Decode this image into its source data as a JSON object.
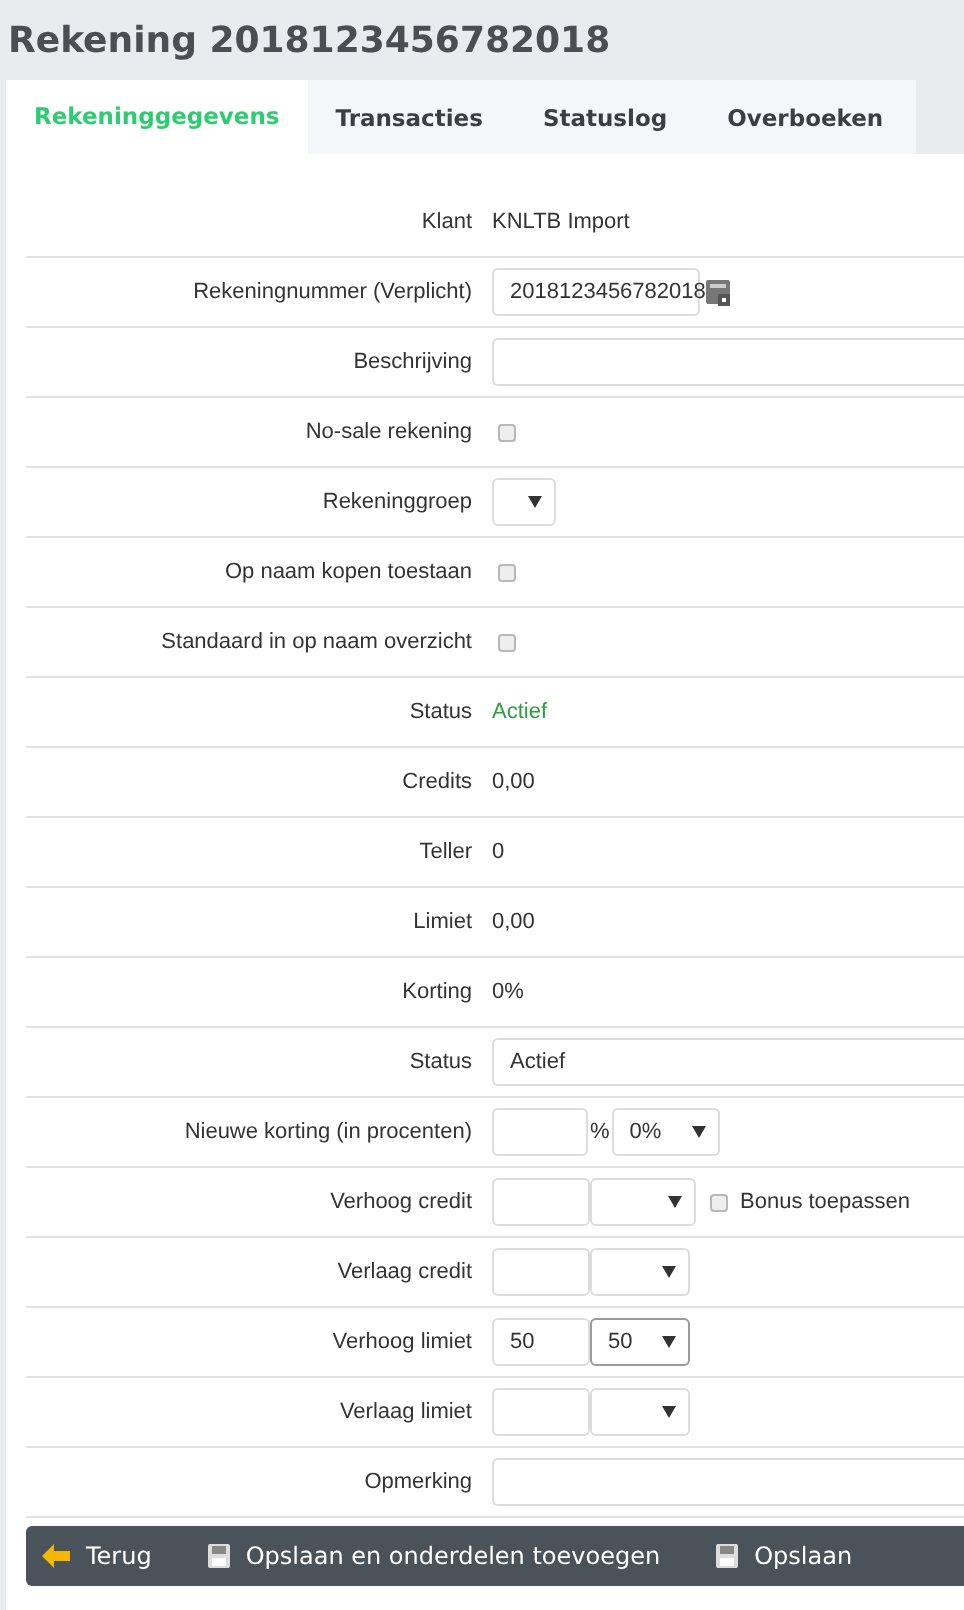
{
  "title": "Rekening 2018123456782018",
  "tabs": [
    {
      "label": "Rekeninggegevens",
      "selected": true
    },
    {
      "label": "Transacties",
      "selected": false
    },
    {
      "label": "Statuslog",
      "selected": false
    },
    {
      "label": "Overboeken",
      "selected": false
    }
  ],
  "rows": [
    {
      "label": "Klant",
      "kind": "text",
      "value": "KNLTB Import"
    },
    {
      "label": "Rekeningnummer (Verplicht)",
      "kind": "field-icon",
      "value": "2018123456782018"
    },
    {
      "label": "Beschrijving",
      "kind": "wide-field"
    },
    {
      "label": "No-sale rekening",
      "kind": "checkbox",
      "checked": false
    },
    {
      "label": "Rekeninggroep",
      "kind": "select"
    },
    {
      "label": "Op naam kopen toestaan",
      "kind": "checkbox",
      "checked": false
    },
    {
      "label": "Standaard in op naam overzicht",
      "kind": "checkbox",
      "checked": false
    },
    {
      "label": "Status",
      "kind": "status-text",
      "value": "Actief"
    },
    {
      "label": "Credits",
      "kind": "text",
      "value": "0,00"
    },
    {
      "label": "Teller",
      "kind": "text",
      "value": "0"
    },
    {
      "label": "Limiet",
      "kind": "text",
      "value": "0,00"
    },
    {
      "label": "Korting",
      "kind": "text",
      "value": "0%"
    },
    {
      "label": "Status",
      "kind": "wide-field",
      "value": "Actief"
    },
    {
      "label": "Nieuwe korting (in procenten)",
      "kind": "percent",
      "unit": "%",
      "select": "0%"
    },
    {
      "label": "Verhoog credit",
      "kind": "amount",
      "bonus": {
        "label": "Bonus toepassen",
        "checked": false
      }
    },
    {
      "label": "Verlaag credit",
      "kind": "amount"
    },
    {
      "label": "Verhoog limiet",
      "kind": "amount",
      "value": "50",
      "select": "50",
      "focused": true
    },
    {
      "label": "Verlaag limiet",
      "kind": "amount"
    },
    {
      "label": "Opmerking",
      "kind": "wide-field"
    }
  ],
  "actions": [
    {
      "label": "Terug",
      "kind": "back"
    },
    {
      "label": "Opslaan en onderdelen toevoegen",
      "kind": "save"
    },
    {
      "label": "Opslaan",
      "kind": "save"
    }
  ]
}
